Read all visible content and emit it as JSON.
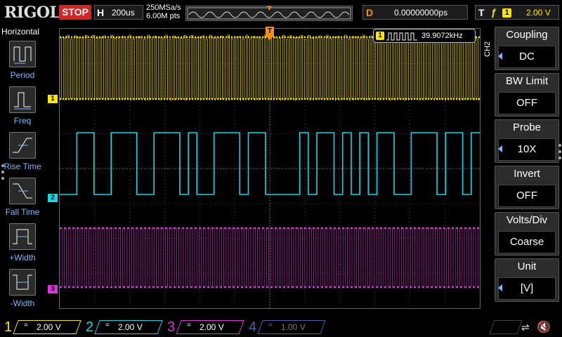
{
  "topbar": {
    "brand": "RIGOL",
    "run_state": "STOP",
    "horizontal_label": "H",
    "timebase": "200us",
    "sample_rate": "250MSa/s",
    "memory_depth": "6.00M pts",
    "delay_label": "D",
    "delay_value": "0.00000000ps",
    "trigger_label": "T",
    "trigger_source": "1",
    "trigger_level": "2.00 V"
  },
  "left_menu": {
    "title": "Horizontal",
    "items": [
      {
        "label": "Period",
        "icon": "period-icon"
      },
      {
        "label": "Freq",
        "icon": "freq-icon"
      },
      {
        "label": "Rise Time",
        "icon": "rise-time-icon"
      },
      {
        "label": "Fall Time",
        "icon": "fall-time-icon"
      },
      {
        "label": "+Width",
        "icon": "positive-width-icon"
      },
      {
        "label": "-Width",
        "icon": "negative-width-icon"
      }
    ]
  },
  "measurement": {
    "channel": "1",
    "value": "39.9072kHz"
  },
  "channel_markers": [
    "1",
    "2",
    "3"
  ],
  "trigger_marker": "T",
  "right_menu": {
    "channel_tab": "CH2",
    "items": [
      {
        "title": "Coupling",
        "value": "DC",
        "has_arrow": true
      },
      {
        "title": "BW Limit",
        "value": "OFF",
        "has_arrow": false
      },
      {
        "title": "Probe",
        "value": "10X",
        "has_arrow": true
      },
      {
        "title": "Invert",
        "value": "OFF",
        "has_arrow": false
      },
      {
        "title": "Volts/Div",
        "value": "Coarse",
        "has_arrow": false
      },
      {
        "title": "Unit",
        "value": "[V]",
        "has_arrow": true
      }
    ]
  },
  "bottom_channels": [
    {
      "num": "1",
      "coupling": "=",
      "scale": "2.00 V",
      "color": "#ffe600",
      "active": true
    },
    {
      "num": "2",
      "coupling": "=",
      "scale": "2.00 V",
      "color": "#19d5e6",
      "active": true
    },
    {
      "num": "3",
      "coupling": "=",
      "scale": "2.00 V",
      "color": "#e033e0",
      "active": true
    },
    {
      "num": "4",
      "coupling": "=",
      "scale": "1.00 V",
      "color": "#4a5fb0",
      "active": false
    }
  ],
  "colors": {
    "ch1": "#ffe600",
    "ch2": "#19d5e6",
    "ch3": "#e033e0",
    "trigger": "#f58f1a",
    "stop": "#d52424"
  },
  "traces": {
    "ch2_bits": [
      0,
      0,
      1,
      1,
      0,
      0,
      1,
      1,
      1,
      0,
      0,
      1,
      1,
      1,
      0,
      1,
      0,
      0,
      1,
      1,
      1,
      0,
      1,
      1,
      0,
      0,
      0,
      0,
      1,
      0,
      1,
      1,
      0,
      1,
      0,
      1,
      0,
      1,
      1,
      0,
      0,
      1,
      1,
      1,
      0,
      1,
      1,
      0,
      1
    ]
  }
}
